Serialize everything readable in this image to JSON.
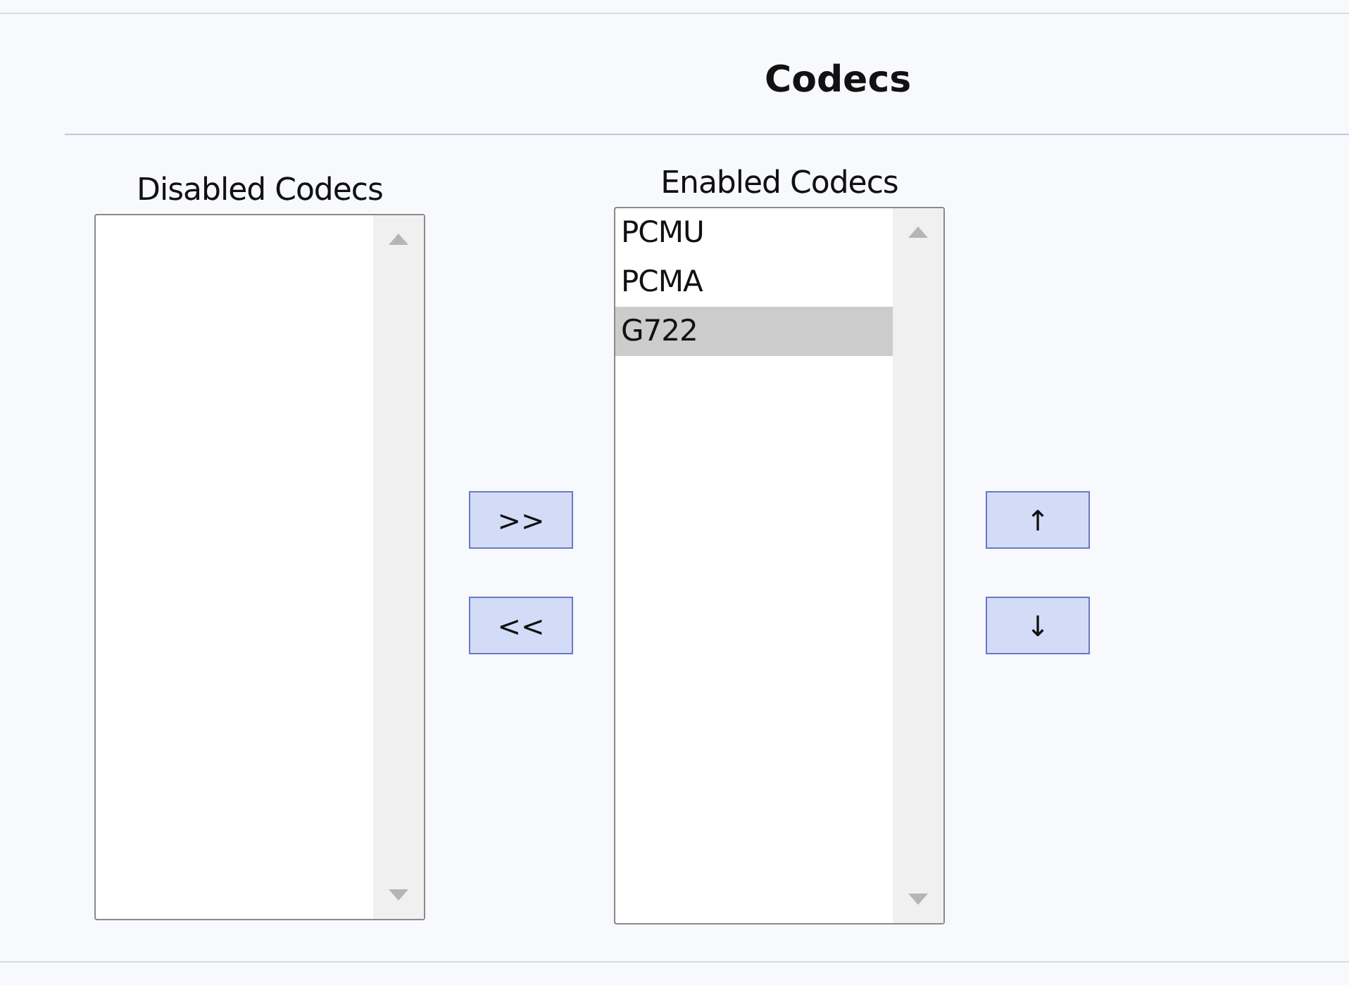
{
  "title": "Codecs",
  "lists": [
    {
      "label": "Disabled Codecs"
    },
    {
      "label": "Enabled Codecs",
      "items": [
        {
          "name": "PCMU",
          "selected": false
        },
        {
          "name": "PCMA",
          "selected": false
        },
        {
          "name": "G722",
          "selected": true
        }
      ]
    }
  ],
  "transfer_buttons": [
    ">>",
    "<<"
  ],
  "order_buttons": [
    "↑",
    "↓"
  ]
}
